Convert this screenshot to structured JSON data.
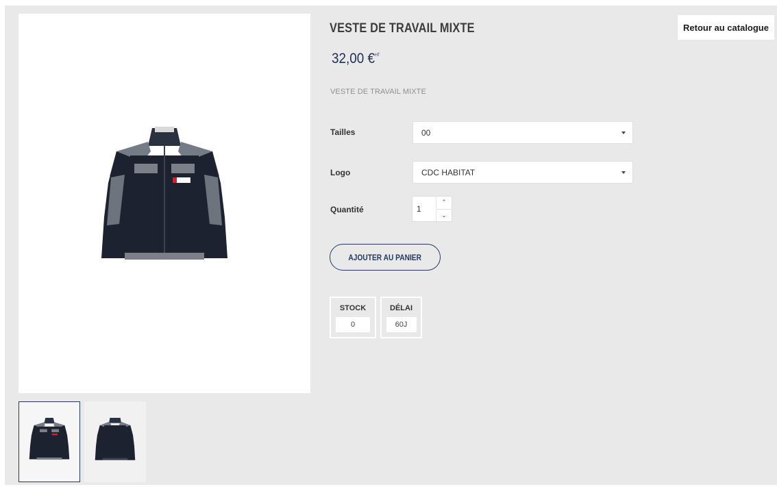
{
  "product": {
    "title": "VESTE DE TRAVAIL MIXTE",
    "price": "32,00 €",
    "price_suffix": "HT",
    "description": "VESTE DE TRAVAIL MIXTE"
  },
  "nav": {
    "back_label": "Retour au catalogue"
  },
  "options": {
    "size_label": "Tailles",
    "size_value": "00",
    "logo_label": "Logo",
    "logo_value": "CDC HABITAT",
    "qty_label": "Quantité",
    "qty_value": "1"
  },
  "actions": {
    "add_to_cart": "AJOUTER AU PANIER"
  },
  "availability": {
    "stock_label": "STOCK",
    "stock_value": "0",
    "delay_label": "DÉLAI",
    "delay_value": "60J"
  },
  "colors": {
    "brand_navy": "#233a5e",
    "background": "#e9e9e9",
    "jacket_black": "#1c2230",
    "jacket_grey": "#7a7f88"
  },
  "icons": [
    "chevron-down-icon",
    "chevron-up-icon",
    "jacket-front-image",
    "jacket-back-image"
  ]
}
